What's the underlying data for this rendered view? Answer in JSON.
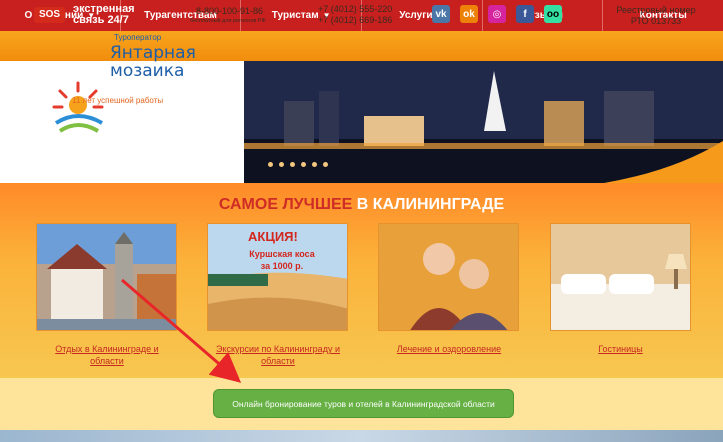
{
  "nav": {
    "items": [
      {
        "label": "О компании",
        "caret": "▼"
      },
      {
        "label": "Турагентствам",
        "caret": ""
      },
      {
        "label": "Туристам",
        "caret": "▼"
      },
      {
        "label": "Услуги",
        "caret": "▼"
      },
      {
        "label": "Отзывы",
        "caret": ""
      },
      {
        "label": "Контакты",
        "caret": ""
      }
    ]
  },
  "infobar": {
    "sos_badge": "SOS",
    "sos_line1": "экстренная",
    "sos_line2": "связь 24/7",
    "phone_main": "8-800-100-91-86",
    "phone_sub": "бесплатный для регионов РФ",
    "phone_extra_1": "+7 (4012) 555-220",
    "phone_extra_2": "+7 (4012) 669-186",
    "registry_line1": "Реестровый номер",
    "registry_line2": "РТО 013733",
    "socials": [
      {
        "icon": "vk-icon",
        "glyph": "vk",
        "color": "#4a76a8"
      },
      {
        "icon": "odnoklassniki-icon",
        "glyph": "ok",
        "color": "#ee8208"
      },
      {
        "icon": "instagram-icon",
        "glyph": "◎",
        "color": "#d6249f"
      },
      {
        "icon": "facebook-icon",
        "glyph": "f",
        "color": "#3b5998"
      },
      {
        "icon": "tripadvisor-icon",
        "glyph": "oo",
        "color": "#34e0a1"
      }
    ]
  },
  "hero": {
    "tour_operator": "Туроператор",
    "brand_line1": "Янтарная",
    "brand_line2": "мозаика",
    "years": "11 лет успешной работы",
    "slide_count": 6
  },
  "section": {
    "title_red": "САМОЕ ЛУЧШЕЕ",
    "title_white": " В КАЛИНИНГРАДЕ",
    "promo_title": "АКЦИЯ!",
    "promo_sub_1": "Куршская коса",
    "promo_sub_2": "за 1000 р.",
    "cards": [
      {
        "caption": "Отдых в Калининграде и области"
      },
      {
        "caption": "Экскурсии по Калининграду и области"
      },
      {
        "caption": "Лечение и оздоровление"
      },
      {
        "caption": "Гостиницы"
      }
    ]
  },
  "booking": {
    "label": "Онлайн бронирование туров и отелей в Калининградской области"
  },
  "colors": {
    "nav_red": "#c8201e",
    "accent_orange": "#f18d0d",
    "button_green": "#66b044",
    "annotation_red": "#e8262a"
  }
}
